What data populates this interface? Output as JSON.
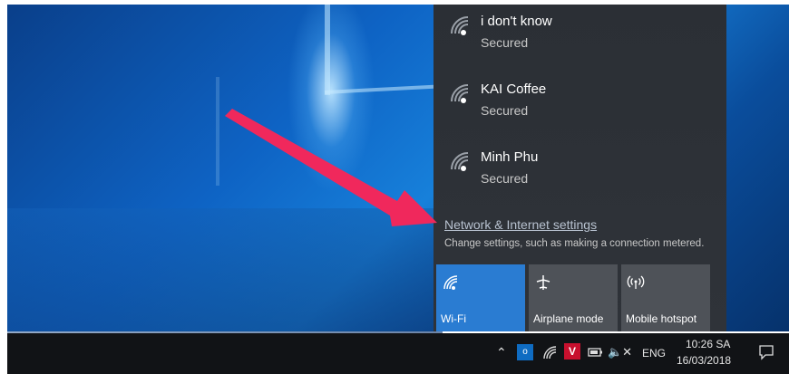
{
  "networks": [
    {
      "name": "i don't know",
      "status": "Secured"
    },
    {
      "name": "KAI Coffee",
      "status": "Secured"
    },
    {
      "name": "Minh Phu",
      "status": "Secured"
    }
  ],
  "settings": {
    "link": "Network & Internet settings",
    "description": "Change settings, such as making a connection metered."
  },
  "quick_actions": [
    {
      "label": "Wi-Fi",
      "icon": "wifi-icon",
      "active": true
    },
    {
      "label": "Airplane mode",
      "icon": "airplane-icon",
      "active": false
    },
    {
      "label": "Mobile hotspot",
      "icon": "hotspot-icon",
      "active": false
    }
  ],
  "taskbar": {
    "language": "ENG",
    "time": "10:26 SA",
    "date": "16/03/2018"
  },
  "colors": {
    "accent": "#2a7cd2",
    "arrow": "#f0285c",
    "panel_bg": "#2d3137",
    "taskbar_bg": "#111316"
  }
}
